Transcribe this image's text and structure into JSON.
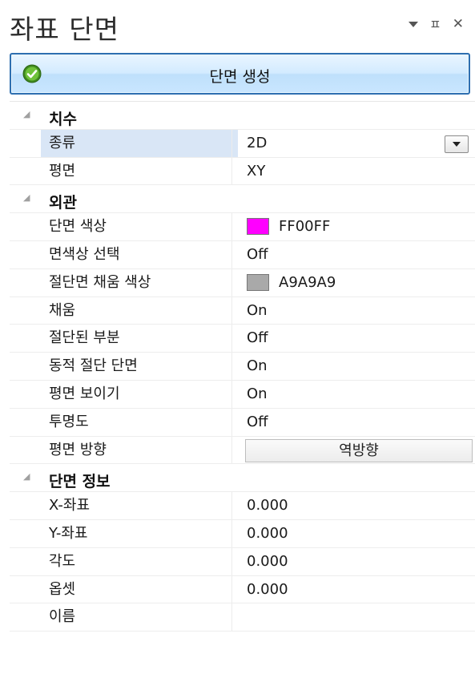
{
  "panel": {
    "title": "좌표 단면",
    "icons": [
      "dropdown-icon",
      "pin-icon",
      "close-icon"
    ],
    "pin_glyph": "ㅍ",
    "close_glyph": "✕"
  },
  "create_button": {
    "label": "단면 생성",
    "icon": "check-circle-icon"
  },
  "categories": {
    "dimensions": {
      "label": "치수"
    },
    "appearance": {
      "label": "외관"
    },
    "section_info": {
      "label": "단면 정보"
    }
  },
  "props": {
    "type": {
      "name": "종류",
      "value": "2D"
    },
    "plane": {
      "name": "평면",
      "value": "XY"
    },
    "section_color": {
      "name": "단면 색상",
      "value": "FF00FF",
      "swatch": "#FF00FF"
    },
    "select_face_color": {
      "name": "면색상 선택",
      "value": "Off"
    },
    "cut_fill_color": {
      "name": "절단면 채움 색상",
      "value": "A9A9A9",
      "swatch": "#A9A9A9"
    },
    "fill": {
      "name": "채움",
      "value": "On"
    },
    "cut_part": {
      "name": "절단된 부분",
      "value": "Off"
    },
    "dynamic_section": {
      "name": "동적 절단 단면",
      "value": "On"
    },
    "show_plane": {
      "name": "평면 보이기",
      "value": "On"
    },
    "transparency": {
      "name": "투명도",
      "value": "Off"
    },
    "plane_direction": {
      "name": "평면 방향",
      "button_label": "역방향"
    },
    "x_coord": {
      "name": "X-좌표",
      "value": "0.000"
    },
    "y_coord": {
      "name": "Y-좌표",
      "value": "0.000"
    },
    "angle": {
      "name": "각도",
      "value": "0.000"
    },
    "offset": {
      "name": "옵셋",
      "value": "0.000"
    },
    "name": {
      "name": "이름",
      "value": ""
    }
  }
}
